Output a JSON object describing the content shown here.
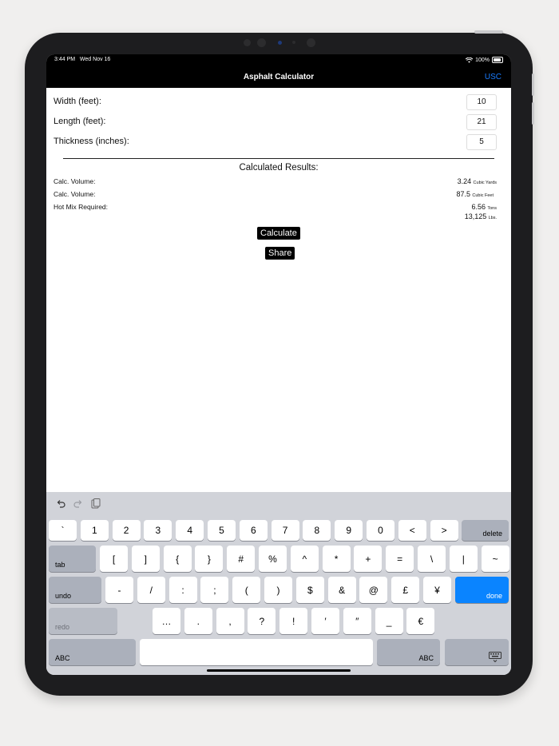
{
  "status": {
    "time": "3:44 PM",
    "date": "Wed Nov 16",
    "battery": "100%"
  },
  "nav": {
    "title": "Asphalt Calculator",
    "unit_toggle": "USC"
  },
  "inputs": [
    {
      "label": "Width (feet):",
      "value": "10"
    },
    {
      "label": "Length (feet):",
      "value": "21"
    },
    {
      "label": "Thickness (inches):",
      "value": "5"
    }
  ],
  "results": {
    "title": "Calculated Results:",
    "rows": [
      {
        "label": "Calc. Volume:",
        "value": "3.24",
        "unit": "Cubic Yards"
      },
      {
        "label": "Calc. Volume:",
        "value": "87.5",
        "unit": "Cubic Feet"
      },
      {
        "label": "Hot Mix Required:",
        "value": "6.56",
        "unit": "Tons",
        "value2": "13,125",
        "unit2": "Lbs."
      }
    ]
  },
  "buttons": {
    "calculate": "Calculate",
    "share": "Share"
  },
  "keyboard": {
    "toolbar": [
      "undo-icon",
      "redo-icon",
      "paste-icon"
    ],
    "row1": [
      "`",
      "1",
      "2",
      "3",
      "4",
      "5",
      "6",
      "7",
      "8",
      "9",
      "0",
      "<",
      ">"
    ],
    "row1_action": "delete",
    "row2_action": "tab",
    "row2": [
      "[",
      "]",
      "{",
      "}",
      "#",
      "%",
      "^",
      "*",
      "+",
      "=",
      "\\",
      "|",
      "~"
    ],
    "row3_action": "undo",
    "row3": [
      "-",
      "/",
      ":",
      ";",
      "(",
      ")",
      "$",
      "&",
      "@",
      "£",
      "¥"
    ],
    "row3_end": "done",
    "row4_action": "redo",
    "row4": [
      "…",
      ".",
      ",",
      "?",
      "!",
      "′",
      "″",
      "_",
      "€"
    ],
    "row5_left": "ABC",
    "row5_right": "ABC",
    "hide_keyboard_icon": "keyboard-dismiss-icon"
  },
  "colors": {
    "accent": "#0a84ff",
    "nav_bg": "#000000",
    "keyboard_bg": "#d1d3d9"
  }
}
